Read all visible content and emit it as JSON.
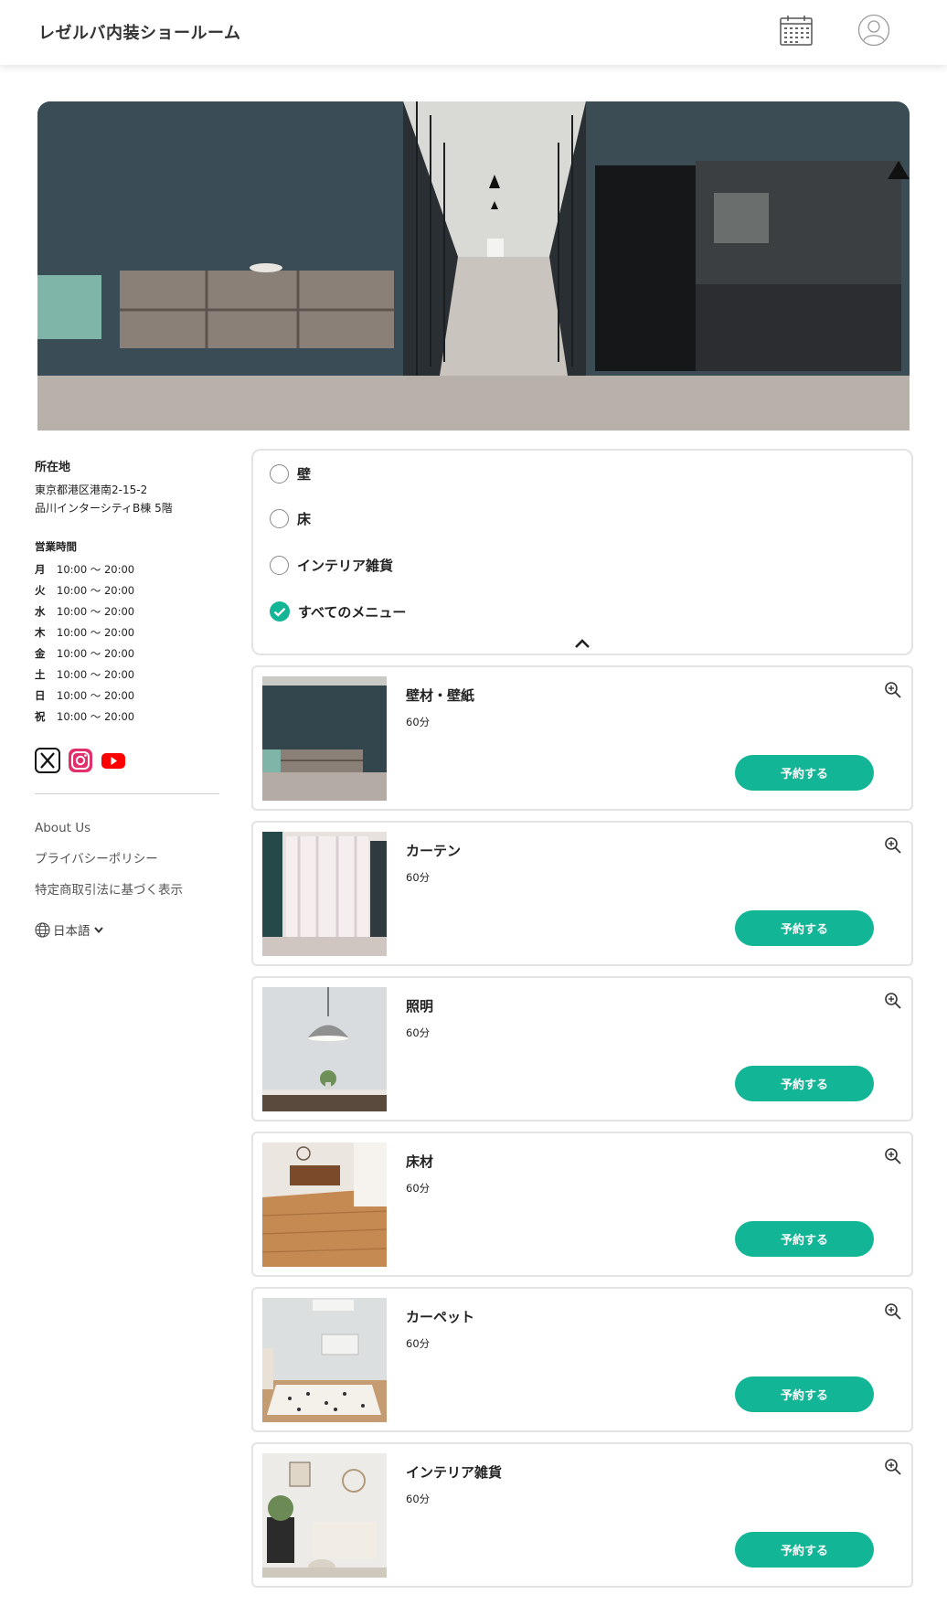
{
  "header": {
    "brand": "レゼルバ内装ショールーム",
    "icons": [
      "calendar-icon",
      "user-icon"
    ]
  },
  "sidebar": {
    "location_label": "所在地",
    "address_line1": "東京都港区港南2-15-2",
    "address_line2": "品川インターシティB棟 5階",
    "hours_label": "営業時間",
    "hours": [
      {
        "day": "月",
        "time": "10:00 〜 20:00"
      },
      {
        "day": "火",
        "time": "10:00 〜 20:00"
      },
      {
        "day": "水",
        "time": "10:00 〜 20:00"
      },
      {
        "day": "木",
        "time": "10:00 〜 20:00"
      },
      {
        "day": "金",
        "time": "10:00 〜 20:00"
      },
      {
        "day": "土",
        "time": "10:00 〜 20:00"
      },
      {
        "day": "日",
        "time": "10:00 〜 20:00"
      },
      {
        "day": "祝",
        "time": "10:00 〜 20:00"
      }
    ],
    "social": [
      "x-icon",
      "instagram-icon",
      "youtube-icon"
    ],
    "links": [
      "About Us",
      "プライバシーポリシー",
      "特定商取引法に基づく表示"
    ],
    "language": "日本語"
  },
  "filter": {
    "options": [
      {
        "label": "壁",
        "selected": false
      },
      {
        "label": "床",
        "selected": false
      },
      {
        "label": "インテリア雑貨",
        "selected": false
      },
      {
        "label": "すべてのメニュー",
        "selected": true
      }
    ]
  },
  "menus": [
    {
      "title": "壁材・壁紙",
      "duration": "60分",
      "button": "予約する"
    },
    {
      "title": "カーテン",
      "duration": "60分",
      "button": "予約する"
    },
    {
      "title": "照明",
      "duration": "60分",
      "button": "予約する"
    },
    {
      "title": "床材",
      "duration": "60分",
      "button": "予約する"
    },
    {
      "title": "カーペット",
      "duration": "60分",
      "button": "予約する"
    },
    {
      "title": "インテリア雑貨",
      "duration": "60分",
      "button": "予約する"
    }
  ],
  "colors": {
    "accent": "#12b595",
    "border": "#e3e3e3"
  }
}
